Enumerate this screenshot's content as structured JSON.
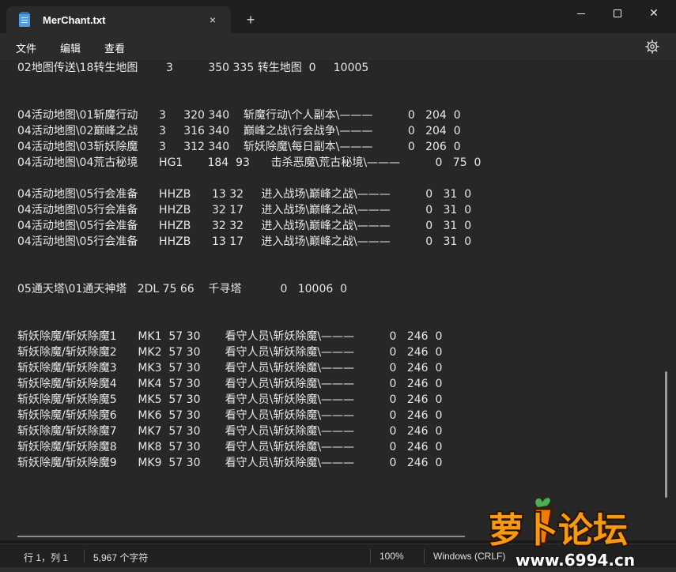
{
  "window": {
    "tab_title": "MerChant.txt",
    "tab_close": "×",
    "new_tab": "+",
    "close": "✕"
  },
  "menu": {
    "file": "文件",
    "edit": "编辑",
    "view": "查看"
  },
  "editor": {
    "lines": [
      "02地图传送\\18转生地图        3          350 335 转生地图  0     10005",
      "",
      "",
      "04活动地图\\01斩魔行动      3     320 340    斩魔行动\\个人副本\\———          0   204  0",
      "04活动地图\\02巅峰之战      3     316 340    巅峰之战\\行会战争\\———          0   204  0",
      "04活动地图\\03斩妖除魔      3     312 340    斩妖除魔\\每日副本\\———          0   206  0",
      "04活动地图\\04荒古秘境      HG1       184  93      击杀恶魔\\荒古秘境\\———          0   75  0",
      "",
      "04活动地图\\05行会准备      HHZB      13 32     进入战场\\巅峰之战\\———          0   31  0",
      "04活动地图\\05行会准备      HHZB      32 17     进入战场\\巅峰之战\\———          0   31  0",
      "04活动地图\\05行会准备      HHZB      32 32     进入战场\\巅峰之战\\———          0   31  0",
      "04活动地图\\05行会准备      HHZB      13 17     进入战场\\巅峰之战\\———          0   31  0",
      "",
      "",
      "05通天塔\\01通天神塔   2DL 75 66    千寻塔           0   10006  0",
      "",
      "",
      "斩妖除魔/斩妖除魔1      MK1  57 30       看守人员\\斩妖除魔\\———          0   246  0",
      "斩妖除魔/斩妖除魔2      MK2  57 30       看守人员\\斩妖除魔\\———          0   246  0",
      "斩妖除魔/斩妖除魔3      MK3  57 30       看守人员\\斩妖除魔\\———          0   246  0",
      "斩妖除魔/斩妖除魔4      MK4  57 30       看守人员\\斩妖除魔\\———          0   246  0",
      "斩妖除魔/斩妖除魔5      MK5  57 30       看守人员\\斩妖除魔\\———          0   246  0",
      "斩妖除魔/斩妖除魔6      MK6  57 30       看守人员\\斩妖除魔\\———          0   246  0",
      "斩妖除魔/斩妖除魔7      MK7  57 30       看守人员\\斩妖除魔\\———          0   246  0",
      "斩妖除魔/斩妖除魔8      MK8  57 30       看守人员\\斩妖除魔\\———          0   246  0",
      "斩妖除魔/斩妖除魔9      MK9  57 30       看守人员\\斩妖除魔\\———          0   246  0"
    ]
  },
  "status": {
    "position": "行 1，列 1",
    "char_count": "5,967 个字符",
    "zoom": "100%",
    "line_ending": "Windows (CRLF)"
  },
  "watermark": {
    "brand": "萝卜论坛",
    "site": "www.6994.cn"
  },
  "colors": {
    "accent": "#4aa0e6",
    "watermark_orange": "#f59a12"
  },
  "icons": {
    "app": "notepad-icon",
    "settings": "gear-icon",
    "close": "close-icon"
  }
}
